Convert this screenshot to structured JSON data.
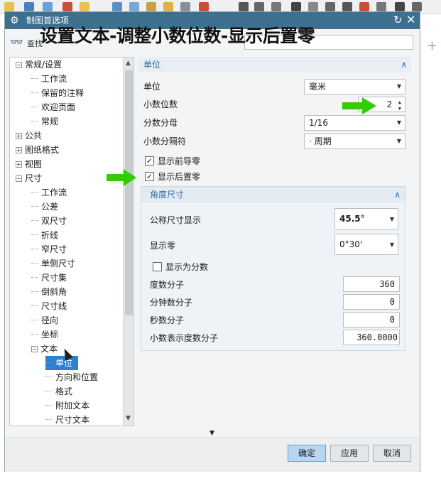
{
  "dialog": {
    "title": "制图首选项",
    "overlay_caption": "设置文本-调整小数位数-显示后置零"
  },
  "search": {
    "label": "查找",
    "value": ""
  },
  "tree": {
    "items": [
      {
        "label": "常规/设置",
        "level": 0,
        "expander": "−"
      },
      {
        "label": "工作流",
        "level": 1,
        "expander": ""
      },
      {
        "label": "保留的注释",
        "level": 1,
        "expander": ""
      },
      {
        "label": "欢迎页面",
        "level": 1,
        "expander": ""
      },
      {
        "label": "常规",
        "level": 1,
        "expander": ""
      },
      {
        "label": "公共",
        "level": 0,
        "expander": "+"
      },
      {
        "label": "图纸格式",
        "level": 0,
        "expander": "+"
      },
      {
        "label": "视图",
        "level": 0,
        "expander": "+"
      },
      {
        "label": "尺寸",
        "level": 0,
        "expander": "−"
      },
      {
        "label": "工作流",
        "level": 1,
        "expander": ""
      },
      {
        "label": "公差",
        "level": 1,
        "expander": ""
      },
      {
        "label": "双尺寸",
        "level": 1,
        "expander": ""
      },
      {
        "label": "折线",
        "level": 1,
        "expander": ""
      },
      {
        "label": "窄尺寸",
        "level": 1,
        "expander": ""
      },
      {
        "label": "单侧尺寸",
        "level": 1,
        "expander": ""
      },
      {
        "label": "尺寸集",
        "level": 1,
        "expander": ""
      },
      {
        "label": "倒斜角",
        "level": 1,
        "expander": ""
      },
      {
        "label": "尺寸线",
        "level": 1,
        "expander": ""
      },
      {
        "label": "径向",
        "level": 1,
        "expander": ""
      },
      {
        "label": "坐标",
        "level": 1,
        "expander": ""
      },
      {
        "label": "文本",
        "level": 1,
        "expander": "−"
      },
      {
        "label": "单位",
        "level": 2,
        "expander": "",
        "selected": true
      },
      {
        "label": "方向和位置",
        "level": 2,
        "expander": ""
      },
      {
        "label": "格式",
        "level": 2,
        "expander": ""
      },
      {
        "label": "附加文本",
        "level": 2,
        "expander": ""
      },
      {
        "label": "尺寸文本",
        "level": 2,
        "expander": ""
      }
    ]
  },
  "units_section": {
    "header": "单位",
    "unit_label": "单位",
    "unit_value": "毫米",
    "decimal_places_label": "小数位数",
    "decimal_places_value": "2",
    "fraction_denominator_label": "分数分母",
    "fraction_denominator_value": "1/16",
    "decimal_separator_label": "小数分隔符",
    "decimal_separator_value": "· 周期",
    "show_leading_zeros_label": "显示前导零",
    "show_leading_zeros_checked": true,
    "show_trailing_zeros_label": "显示后置零",
    "show_trailing_zeros_checked": true
  },
  "angle_section": {
    "header": "角度尺寸",
    "nominal_display_label": "公称尺寸显示",
    "nominal_display_value": "45.5°",
    "show_zeros_label": "显示零",
    "show_zeros_value": "0°30'",
    "show_as_fraction_label": "显示为分数",
    "show_as_fraction_checked": false,
    "degree_numerator_label": "度数分子",
    "degree_numerator_value": "360",
    "minute_numerator_label": "分钟数分子",
    "minute_numerator_value": "0",
    "second_numerator_label": "秒数分子",
    "second_numerator_value": "0",
    "decimal_degree_numerator_label": "小数表示度数分子",
    "decimal_degree_numerator_value": "360.0000"
  },
  "buttons": {
    "ok": "确定",
    "apply": "应用",
    "cancel": "取消"
  },
  "colors": {
    "title_bar": "#3d6f8f",
    "accent": "#2f7fd0",
    "annotation_arrow": "#33cc00"
  }
}
